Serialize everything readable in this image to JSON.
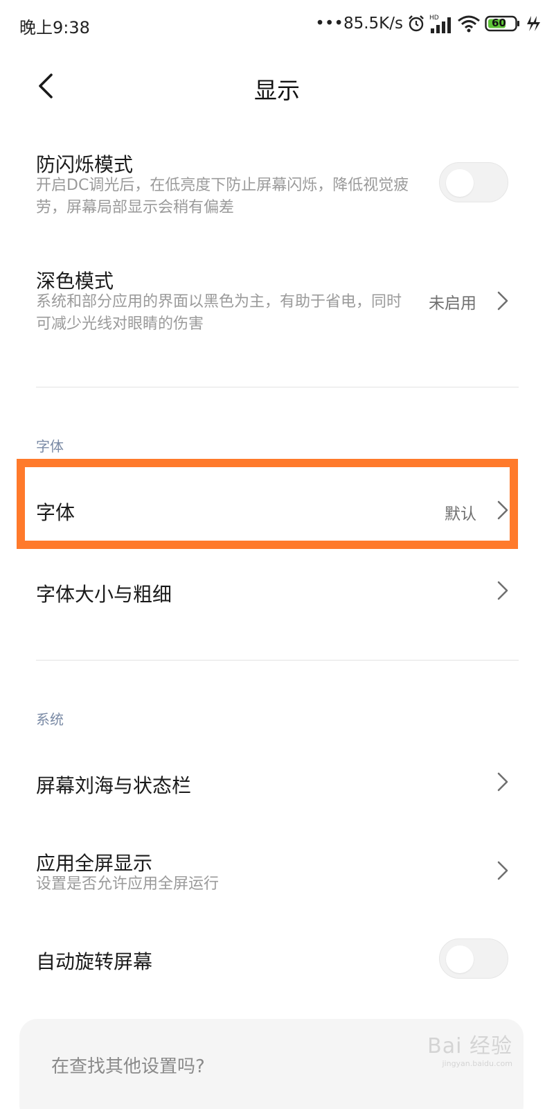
{
  "status_bar": {
    "time": "晚上9:38",
    "network": "•••85.5K/s",
    "battery": "60",
    "hd": "HD"
  },
  "header": {
    "title": "显示"
  },
  "items": {
    "flicker": {
      "title": "防闪烁模式",
      "desc": "开启DC调光后，在低亮度下防止屏幕闪烁，降低视觉疲劳，屏幕局部显示会稍有偏差"
    },
    "dark": {
      "title": "深色模式",
      "desc": "系统和部分应用的界面以黑色为主，有助于省电，同时可减少光线对眼睛的伤害",
      "value": "未启用"
    },
    "font": {
      "title": "字体",
      "value": "默认"
    },
    "font_size": {
      "title": "字体大小与粗细"
    },
    "notch": {
      "title": "屏幕刘海与状态栏"
    },
    "fullscreen": {
      "title": "应用全屏显示",
      "desc": "设置是否允许应用全屏运行"
    },
    "rotate": {
      "title": "自动旋转屏幕"
    }
  },
  "sections": {
    "font": "字体",
    "system": "系统"
  },
  "search": {
    "placeholder": "在查找其他设置吗?"
  },
  "watermark": {
    "main": "Bai 经验",
    "sub": "jingyan.baidu.com"
  },
  "colors": {
    "highlight": "#ff7a2b",
    "section_label": "#7a8aa5"
  }
}
